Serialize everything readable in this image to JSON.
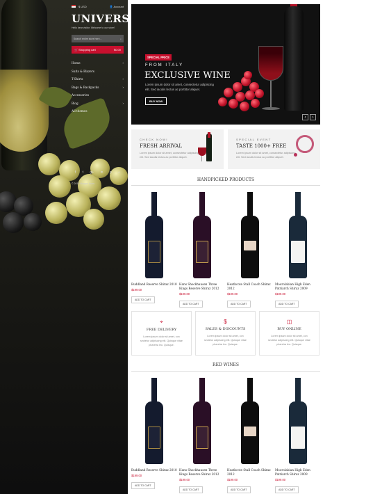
{
  "topbar": {
    "currency": "$ USD",
    "account": "Account"
  },
  "logo": "UNIVERSAL",
  "tagline": "Hello dear visitor. Welcome to our store!",
  "search": {
    "placeholder": "Search entire store here..."
  },
  "cart": {
    "label": "Shopping cart",
    "total": "$0.00"
  },
  "menu": [
    {
      "label": "Home",
      "arrow": "›"
    },
    {
      "label": "Suits & Blazers",
      "arrow": ""
    },
    {
      "label": "T-Shirts",
      "arrow": "›"
    },
    {
      "label": "Bags & Backpacks",
      "arrow": "›"
    },
    {
      "label": "Accessories",
      "arrow": ""
    },
    {
      "label": "Blog",
      "arrow": "›"
    },
    {
      "label": "All themes",
      "arrow": ""
    }
  ],
  "social": [
    "f",
    "t",
    "g+",
    "in",
    "p",
    "⌂"
  ],
  "copyright": "© 2015 Margon team.",
  "hero": {
    "badge": "SPECIAL PRICE",
    "from": "FROM ITALY",
    "title": "EXCLUSIVE WINE",
    "desc": "Lorem ipsum dolor sit amet, consectetur adipiscing elit. Sed iaculis lectus ac porttitor aliquet.",
    "button": "BUY NOW"
  },
  "promos": [
    {
      "kicker": "CHECK NOW!",
      "title": "FRESH ARRIVAL",
      "desc": "Lorem ipsum dolor sit amet, consectetur adipiscing elit. Sed iaculis lectus ac porttitor aliquet."
    },
    {
      "kicker": "SPECIAL EVENT",
      "title": "TASTE 1000+ FREE",
      "desc": "Lorem ipsum dolor sit amet, consectetur adipiscing elit. Sed iaculis lectus ac porttitor aliquet."
    }
  ],
  "sections": {
    "handpicked": "HANDPICKED PRODUCTS",
    "red": "RED WINES"
  },
  "add_to_cart": "ADD TO CART",
  "products": [
    {
      "name": "Buddland Reserve Shiraz 2010",
      "price": "$199.00",
      "body": "#141b2e",
      "label": "#1d2236"
    },
    {
      "name": "Hans Shockhausen Three Kings Reserve Shiraz 2012",
      "price": "$199.00",
      "body": "#2a0f26",
      "label": "#3a2033"
    },
    {
      "name": "Heathcote Stall Coach Shiraz 2012",
      "price": "$199.00",
      "body": "#0d0d0d",
      "label": "#e8d6c6"
    },
    {
      "name": "Moorolabian High Eden Patriarch Shiraz 2009",
      "price": "$199.00",
      "body": "#1a2a3a",
      "label": "#f4f4f2"
    }
  ],
  "features": [
    {
      "icon": "⌖",
      "title": "FREE DELIVERY",
      "desc": "Lorem ipsum dolor sit amet, con sectetur adipiscing elit. Quisque vitae pharetra leo. Quisque."
    },
    {
      "icon": "$",
      "title": "SALES & DISCOUNTS",
      "desc": "Lorem ipsum dolor sit amet, con sectetur adipiscing elit. Quisque vitae pharetra leo. Quisque."
    },
    {
      "icon": "◫",
      "title": "BUY ONLINE",
      "desc": "Lorem ipsum dolor sit amet, con sectetur adipiscing elit. Quisque vitae pharetra leo. Quisque."
    }
  ]
}
